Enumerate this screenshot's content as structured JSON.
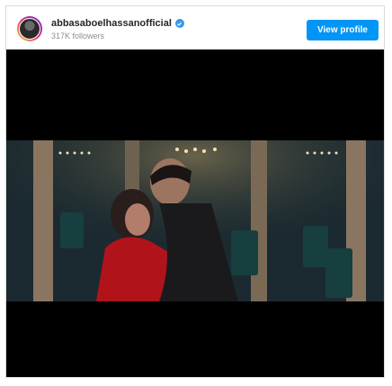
{
  "post": {
    "username": "abbasaboelhassanofficial",
    "followers": "317K followers",
    "view_profile_label": "View profile"
  },
  "icons": {
    "verified": "verified-badge-icon",
    "avatar": "profile-avatar"
  },
  "colors": {
    "button_bg": "#0095f6",
    "verified": "#3897f0"
  }
}
